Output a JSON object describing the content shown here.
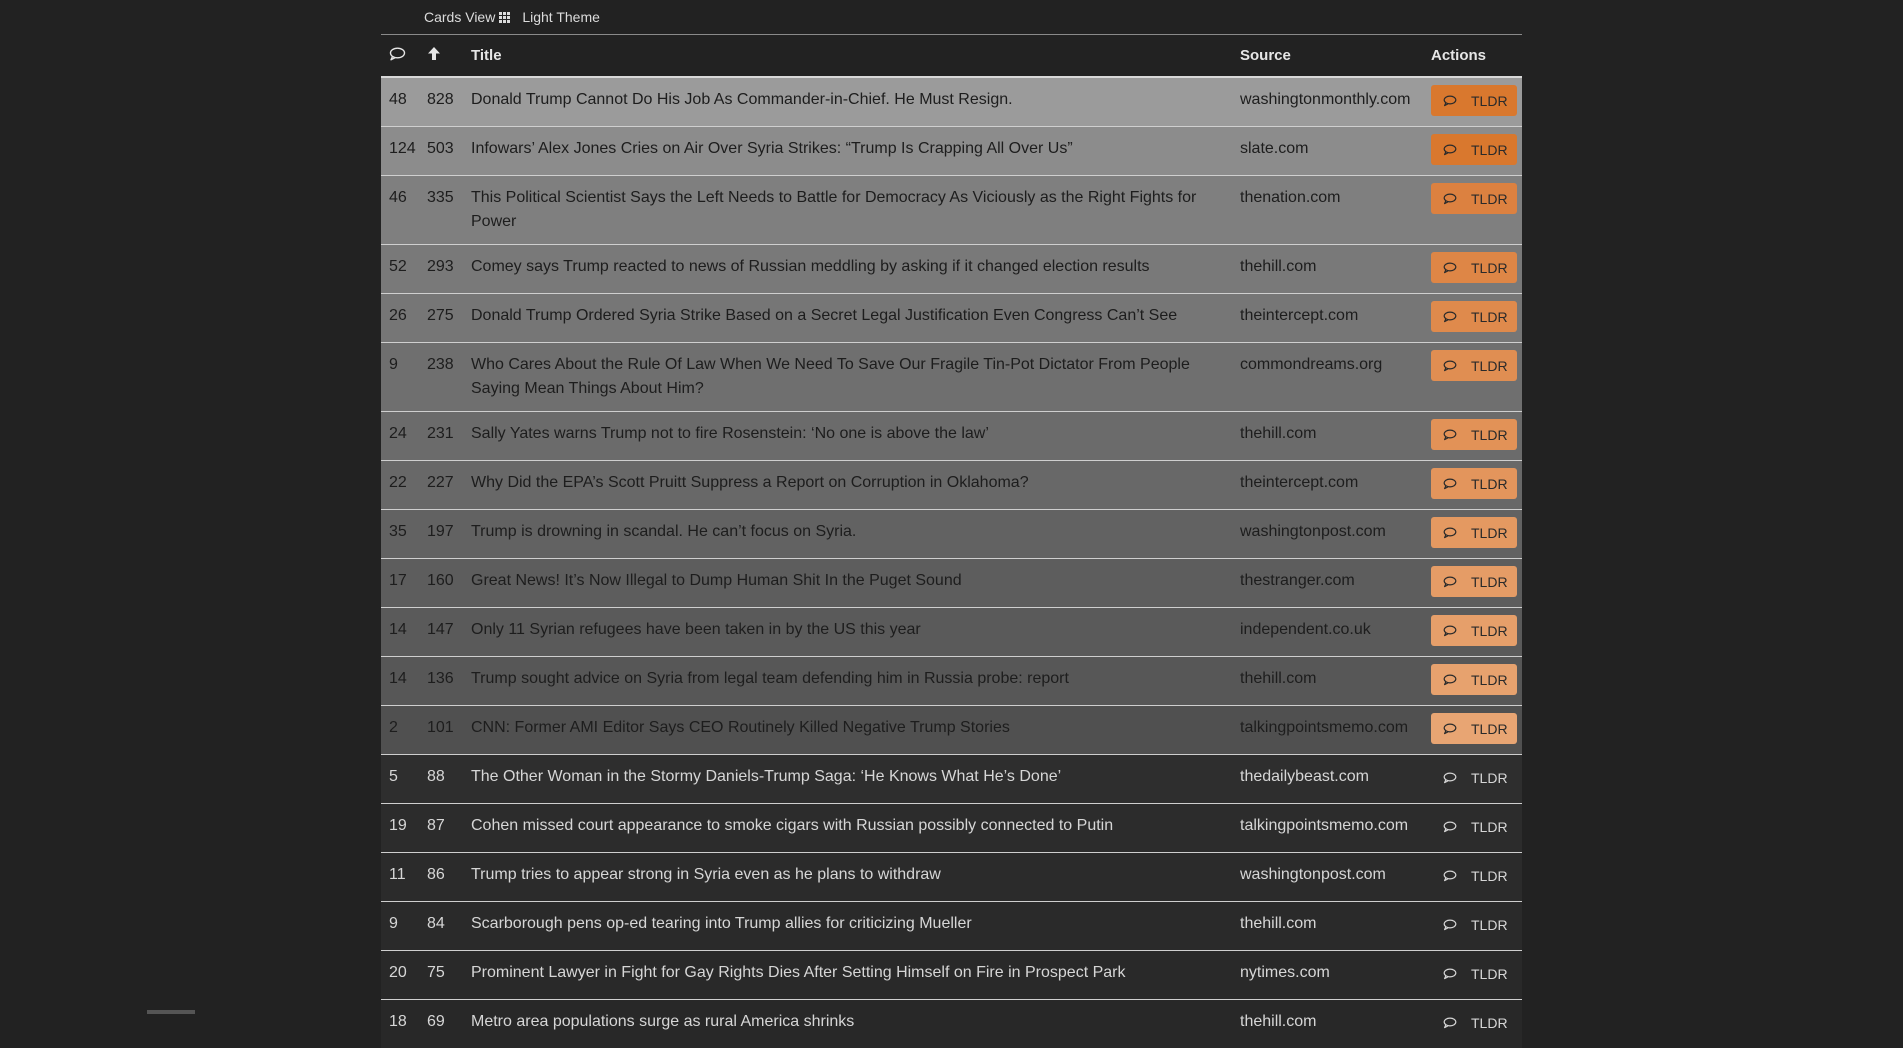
{
  "topbar": {
    "cards_view_label": "Cards View",
    "cards_view_icon": "grid-icon",
    "theme_label": "Light Theme"
  },
  "table": {
    "headers": {
      "comments_icon": "comment-icon",
      "score_icon": "arrow-up-icon",
      "title": "Title",
      "source": "Source",
      "actions": "Actions"
    },
    "tldr_label": "TLDR",
    "rows": [
      {
        "comments": "48",
        "score": "828",
        "title": "Donald Trump Cannot Do His Job As Commander-in-Chief. He Must Resign.",
        "source": "washingtonmonthly.com",
        "bg": "#9b9b9b",
        "btn": "#d9782e"
      },
      {
        "comments": "124",
        "score": "503",
        "title": "Infowars’ Alex Jones Cries on Air Over Syria Strikes: “Trump Is Crapping All Over Us”",
        "source": "slate.com",
        "bg": "#8c8c8c",
        "btn": "#d9782e"
      },
      {
        "comments": "46",
        "score": "335",
        "title": "This Political Scientist Says the Left Needs to Battle for Democracy As Viciously as the Right Fights for Power",
        "source": "thenation.com",
        "bg": "#7f7f7f",
        "btn": "#dc8140"
      },
      {
        "comments": "52",
        "score": "293",
        "title": "Comey says Trump reacted to news of Russian meddling by asking if it changed election results",
        "source": "thehill.com",
        "bg": "#797979",
        "btn": "#de8646"
      },
      {
        "comments": "26",
        "score": "275",
        "title": "Donald Trump Ordered Syria Strike Based on a Secret Legal Justification Even Congress Can’t See",
        "source": "theintercept.com",
        "bg": "#767676",
        "btn": "#df8a4c"
      },
      {
        "comments": "9",
        "score": "238",
        "title": "Who Cares About the Rule Of Law When We Need To Save Our Fragile Tin-Pot Dictator From People Saying Mean Things About Him?",
        "source": "commondreams.org",
        "bg": "#6f6f6f",
        "btn": "#e08e52"
      },
      {
        "comments": "24",
        "score": "231",
        "title": "Sally Yates warns Trump not to fire Rosenstein: ‘No one is above the law’",
        "source": "thehill.com",
        "bg": "#6b6b6b",
        "btn": "#e29257"
      },
      {
        "comments": "22",
        "score": "227",
        "title": "Why Did the EPA’s Scott Pruitt Suppress a Report on Corruption in Oklahoma?",
        "source": "theintercept.com",
        "bg": "#686868",
        "btn": "#e3955c"
      },
      {
        "comments": "35",
        "score": "197",
        "title": "Trump is drowning in scandal. He can’t focus on Syria.",
        "source": "washingtonpost.com",
        "bg": "#626262",
        "btn": "#e49961"
      },
      {
        "comments": "17",
        "score": "160",
        "title": "Great News! It’s Now Illegal to Dump Human Shit In the Puget Sound",
        "source": "thestranger.com",
        "bg": "#5d5d5d",
        "btn": "#e59c66"
      },
      {
        "comments": "14",
        "score": "147",
        "title": "Only 11 Syrian refugees have been taken in by the US this year",
        "source": "independent.co.uk",
        "bg": "#5a5a5a",
        "btn": "#e69f6a"
      },
      {
        "comments": "14",
        "score": "136",
        "title": "Trump sought advice on Syria from legal team defending him in Russia probe: report",
        "source": "thehill.com",
        "bg": "#575757",
        "btn": "#e7a26e"
      },
      {
        "comments": "2",
        "score": "101",
        "title": "CNN: Former AMI Editor Says CEO Routinely Killed Negative Trump Stories",
        "source": "talkingpointsmemo.com",
        "bg": "#505050",
        "btn": "#e8a573"
      },
      {
        "comments": "5",
        "score": "88",
        "title": "The Other Woman in the Stormy Daniels-Trump Saga: ‘He Knows What He’s Done’",
        "source": "thedailybeast.com",
        "bg": "#2e2e2e",
        "btn": ""
      },
      {
        "comments": "19",
        "score": "87",
        "title": "Cohen missed court appearance to smoke cigars with Russian possibly connected to Putin",
        "source": "talkingpointsmemo.com",
        "bg": "#2c2c2c",
        "btn": ""
      },
      {
        "comments": "11",
        "score": "86",
        "title": "Trump tries to appear strong in Syria even as he plans to withdraw",
        "source": "washingtonpost.com",
        "bg": "#2b2b2b",
        "btn": ""
      },
      {
        "comments": "9",
        "score": "84",
        "title": "Scarborough pens op-ed tearing into Trump allies for criticizing Mueller",
        "source": "thehill.com",
        "bg": "#2a2a2a",
        "btn": ""
      },
      {
        "comments": "20",
        "score": "75",
        "title": "Prominent Lawyer in Fight for Gay Rights Dies After Setting Himself on Fire in Prospect Park",
        "source": "nytimes.com",
        "bg": "#292929",
        "btn": ""
      },
      {
        "comments": "18",
        "score": "69",
        "title": "Metro area populations surge as rural America shrinks",
        "source": "thehill.com",
        "bg": "#282828",
        "btn": ""
      }
    ]
  }
}
